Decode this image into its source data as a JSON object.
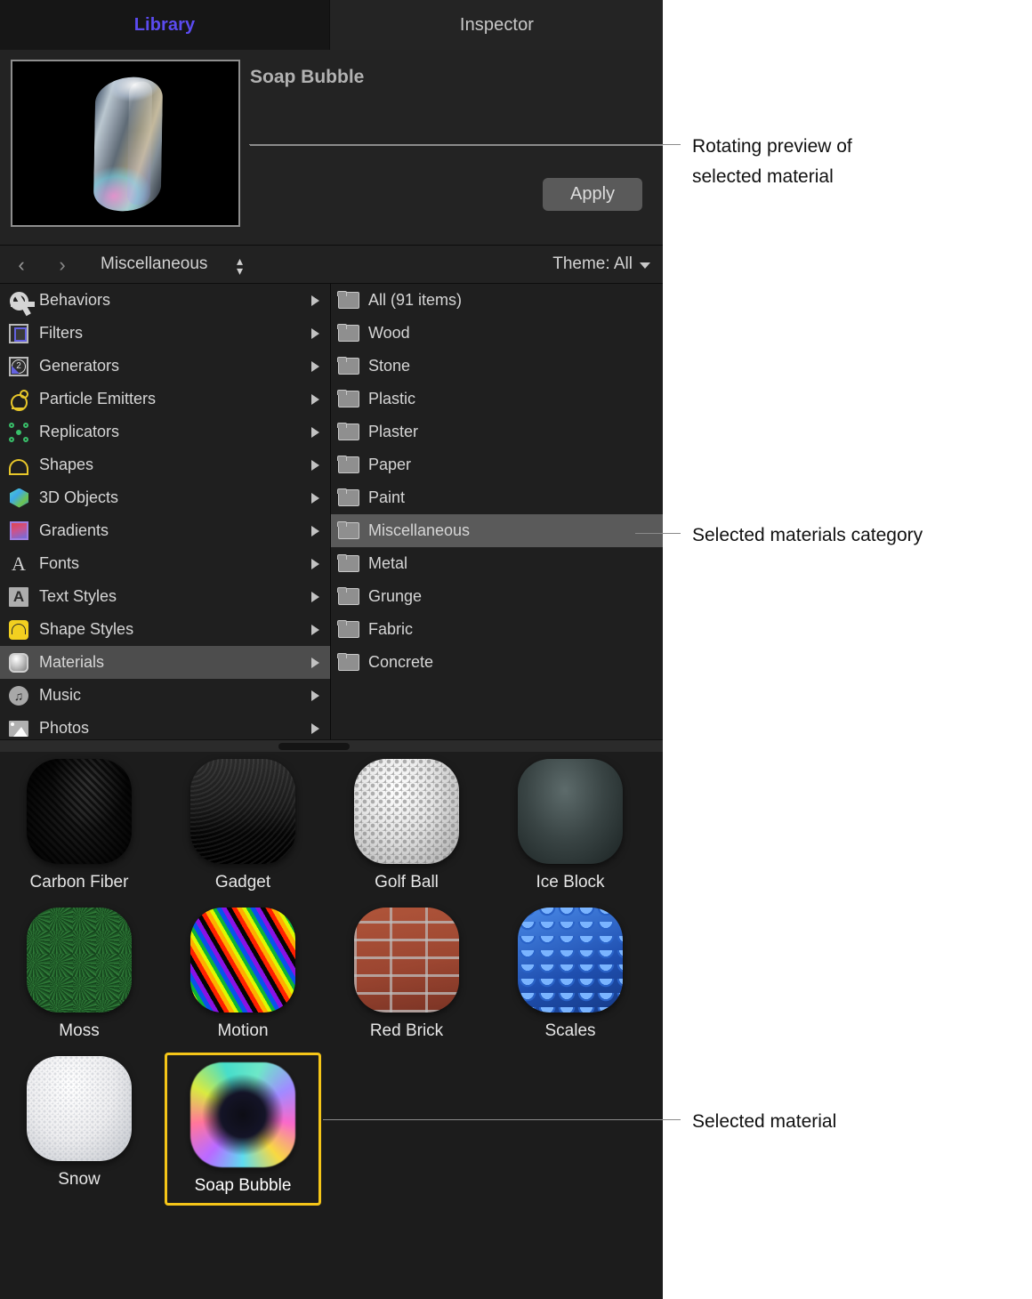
{
  "tabs": [
    {
      "label": "Library",
      "selected": true
    },
    {
      "label": "Inspector",
      "selected": false
    }
  ],
  "preview": {
    "title": "Soap Bubble",
    "apply_label": "Apply",
    "thumbnail_alt": "soap-bubble-rotating-preview"
  },
  "pathbar": {
    "back_glyph": "‹",
    "forward_glyph": "›",
    "path_label": "Miscellaneous",
    "stepper_up": "▴",
    "stepper_down": "▾",
    "theme_label": "Theme: All"
  },
  "sidebar": {
    "items": [
      {
        "label": "Behaviors",
        "icon": "gear-icon",
        "selected": false
      },
      {
        "label": "Filters",
        "icon": "film-icon",
        "selected": false
      },
      {
        "label": "Generators",
        "icon": "generator-icon",
        "selected": false
      },
      {
        "label": "Particle Emitters",
        "icon": "emitter-icon",
        "selected": false
      },
      {
        "label": "Replicators",
        "icon": "replicator-icon",
        "selected": false
      },
      {
        "label": "Shapes",
        "icon": "shape-icon",
        "selected": false
      },
      {
        "label": "3D Objects",
        "icon": "cube-icon",
        "selected": false
      },
      {
        "label": "Gradients",
        "icon": "gradient-icon",
        "selected": false
      },
      {
        "label": "Fonts",
        "icon": "font-icon",
        "selected": false
      },
      {
        "label": "Text Styles",
        "icon": "text-style-icon",
        "selected": false
      },
      {
        "label": "Shape Styles",
        "icon": "shape-style-icon",
        "selected": false
      },
      {
        "label": "Materials",
        "icon": "material-icon",
        "selected": true
      },
      {
        "label": "Music",
        "icon": "music-icon",
        "selected": false
      },
      {
        "label": "Photos",
        "icon": "photo-icon",
        "selected": false
      }
    ]
  },
  "categories": {
    "items": [
      {
        "label": "All (91 items)",
        "selected": false
      },
      {
        "label": "Wood",
        "selected": false
      },
      {
        "label": "Stone",
        "selected": false
      },
      {
        "label": "Plastic",
        "selected": false
      },
      {
        "label": "Plaster",
        "selected": false
      },
      {
        "label": "Paper",
        "selected": false
      },
      {
        "label": "Paint",
        "selected": false
      },
      {
        "label": "Miscellaneous",
        "selected": true
      },
      {
        "label": "Metal",
        "selected": false
      },
      {
        "label": "Grunge",
        "selected": false
      },
      {
        "label": "Fabric",
        "selected": false
      },
      {
        "label": "Concrete",
        "selected": false
      }
    ]
  },
  "materials": {
    "items": [
      {
        "label": "Carbon Fiber",
        "swatch": "sw-carbon",
        "selected": false
      },
      {
        "label": "Gadget",
        "swatch": "sw-gadget",
        "selected": false
      },
      {
        "label": "Golf Ball",
        "swatch": "sw-golf",
        "selected": false
      },
      {
        "label": "Ice Block",
        "swatch": "sw-ice",
        "selected": false
      },
      {
        "label": "Moss",
        "swatch": "sw-moss",
        "selected": false
      },
      {
        "label": "Motion",
        "swatch": "sw-motion",
        "selected": false
      },
      {
        "label": "Red Brick",
        "swatch": "sw-brick",
        "selected": false
      },
      {
        "label": "Scales",
        "swatch": "sw-scales",
        "selected": false
      },
      {
        "label": "Snow",
        "swatch": "sw-snow",
        "selected": false
      },
      {
        "label": "Soap Bubble",
        "swatch": "sw-soap",
        "selected": true
      }
    ]
  },
  "annotations": [
    {
      "text": "Rotating preview of\nselected material"
    },
    {
      "text": "Selected materials category"
    },
    {
      "text": "Selected material"
    }
  ],
  "colors": {
    "panel_bg": "#1c1c1c",
    "tab_active_text": "#5b4bf0",
    "selection_gray": "#5a5a5a",
    "selection_highlight": "#4d4d4d",
    "selected_material_border": "#f5c518",
    "annotation_text": "#111111",
    "leader_line": "#8a8a8a"
  }
}
